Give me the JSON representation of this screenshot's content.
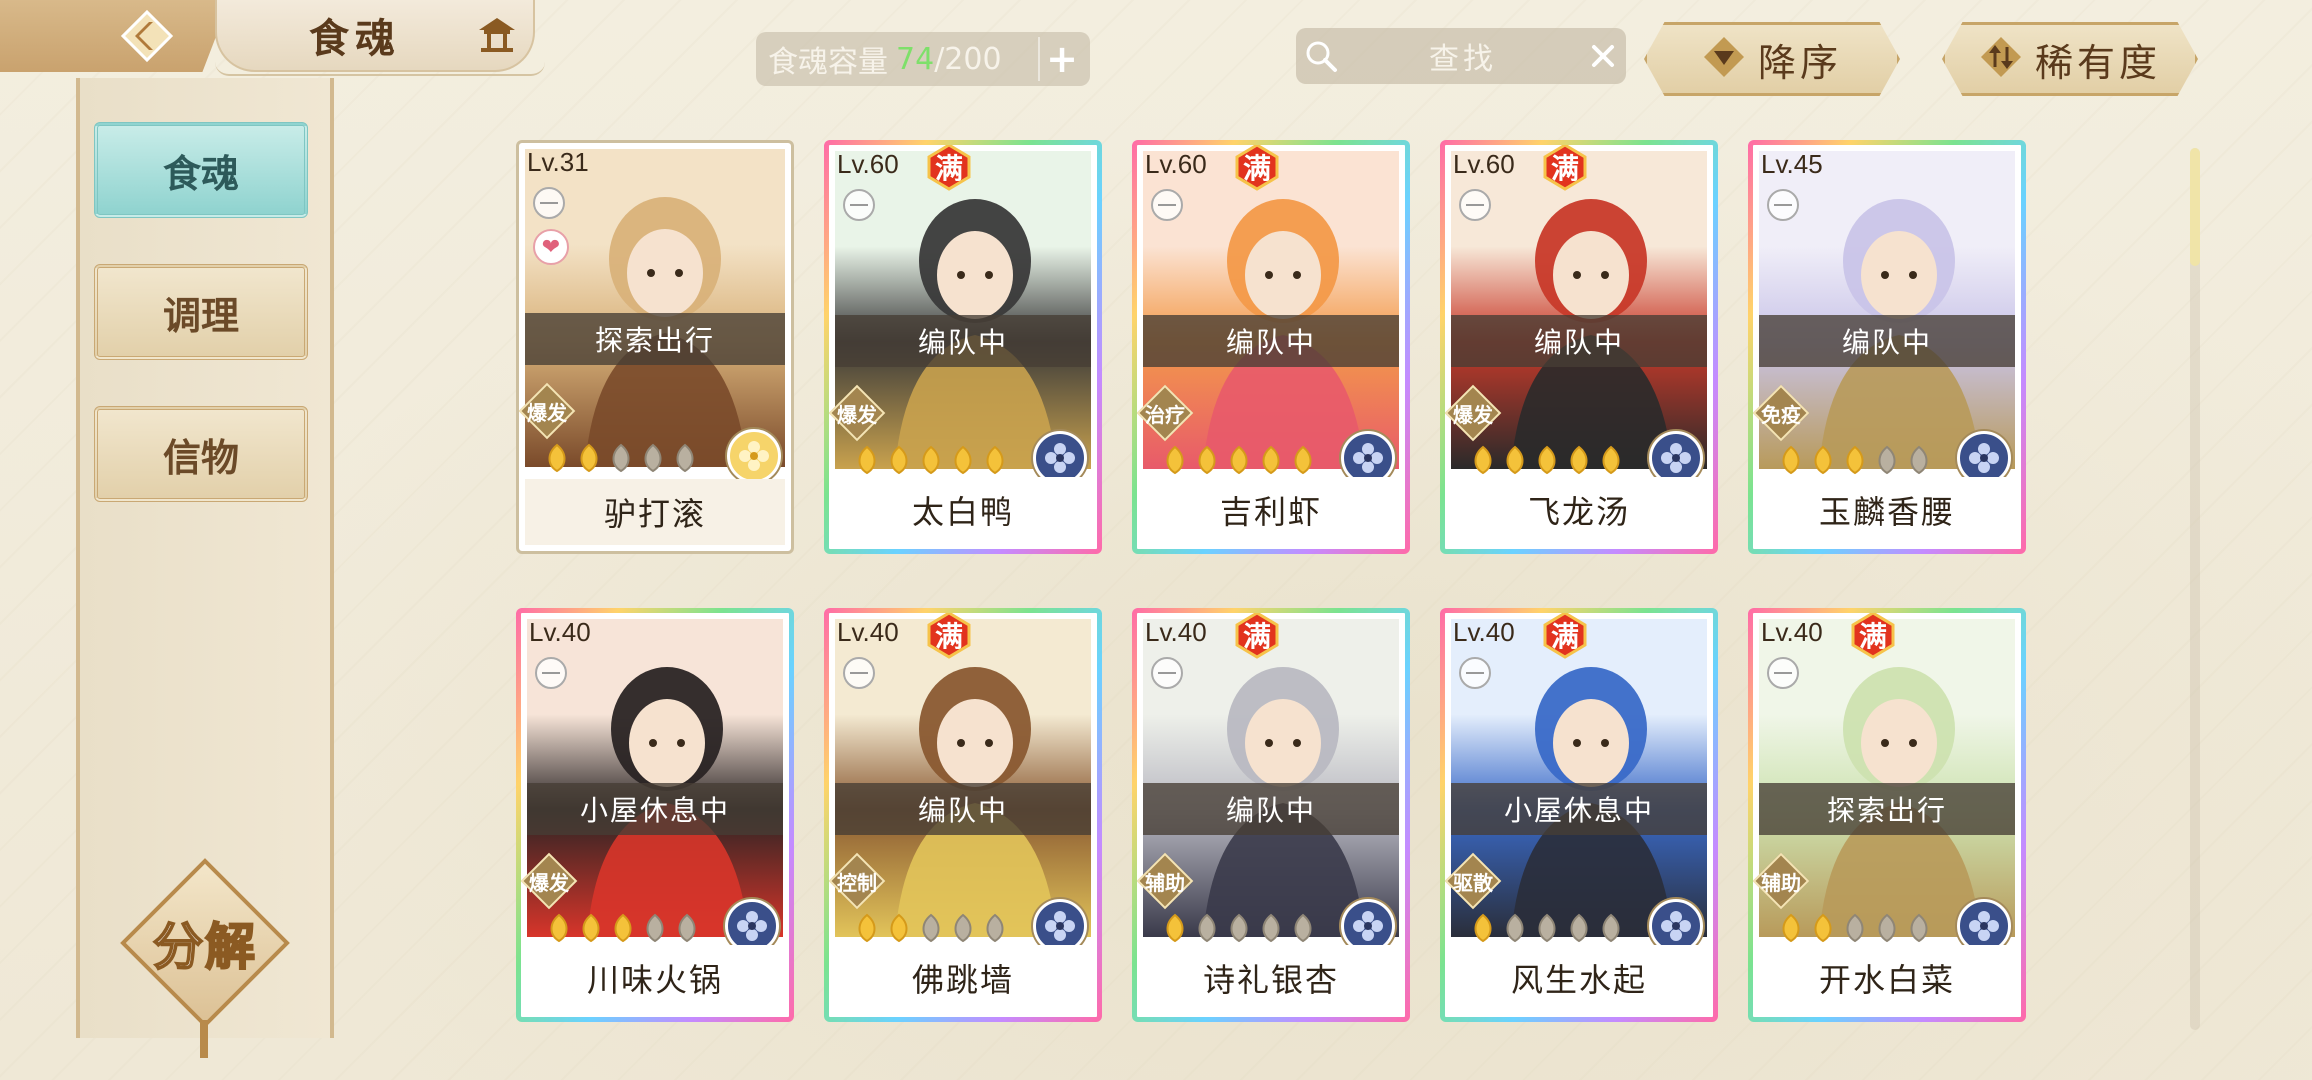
{
  "header": {
    "title": "食魂",
    "capacity": {
      "label": "食魂容量",
      "current": "74",
      "max": "/200"
    },
    "search_label": "查找",
    "sort_order_label": "降序",
    "sort_field_label": "稀有度"
  },
  "sidebar": {
    "tabs": [
      {
        "label": "食魂",
        "active": true
      },
      {
        "label": "调理",
        "active": false
      },
      {
        "label": "信物",
        "active": false
      }
    ],
    "decompose_label": "分解"
  },
  "card_badges": {
    "full": "满"
  },
  "cards": [
    {
      "level": "Lv.31",
      "full": false,
      "status": "探索出行",
      "role": "爆发",
      "stars": 2,
      "name": "驴打滚",
      "rare": false,
      "heart": true,
      "element": "gold-flower",
      "art": [
        "#f3e2c6",
        "#d9b27a",
        "#7a4a2a"
      ]
    },
    {
      "level": "Lv.60",
      "full": true,
      "status": "编队中",
      "role": "爆发",
      "stars": 5,
      "name": "太白鸭",
      "rare": true,
      "heart": false,
      "element": "blue-flower",
      "art": [
        "#e9f4e8",
        "#3a3a3a",
        "#c9a24e"
      ]
    },
    {
      "level": "Lv.60",
      "full": true,
      "status": "编队中",
      "role": "治疗",
      "stars": 5,
      "name": "吉利虾",
      "rare": true,
      "heart": false,
      "element": "blue-flower",
      "art": [
        "#fbe3d3",
        "#f39a4a",
        "#e85a6a"
      ]
    },
    {
      "level": "Lv.60",
      "full": true,
      "status": "编队中",
      "role": "爆发",
      "stars": 5,
      "name": "飞龙汤",
      "rare": true,
      "heart": false,
      "element": "blue-flower",
      "art": [
        "#f7e8d8",
        "#c83a2a",
        "#2a2a2a"
      ]
    },
    {
      "level": "Lv.45",
      "full": false,
      "status": "编队中",
      "role": "免疫",
      "stars": 3,
      "name": "玉麟香腰",
      "rare": true,
      "heart": false,
      "element": "blue-flower",
      "art": [
        "#f0eef8",
        "#c9c4e8",
        "#b89a5a"
      ]
    },
    {
      "level": "Lv.40",
      "full": false,
      "status": "小屋休息中",
      "role": "爆发",
      "stars": 3,
      "name": "川味火锅",
      "rare": true,
      "heart": false,
      "element": "blue-flower",
      "art": [
        "#f7e4d8",
        "#2a2424",
        "#d8352a"
      ]
    },
    {
      "level": "Lv.40",
      "full": true,
      "status": "编队中",
      "role": "控制",
      "stars": 2,
      "name": "佛跳墙",
      "rare": true,
      "heart": false,
      "element": "blue-flower",
      "art": [
        "#f4ead2",
        "#8a5a32",
        "#e2c45a"
      ]
    },
    {
      "level": "Lv.40",
      "full": true,
      "status": "编队中",
      "role": "辅助",
      "stars": 1,
      "name": "诗礼银杏",
      "rare": true,
      "heart": false,
      "element": "blue-flower",
      "art": [
        "#eef0ea",
        "#b9b9c2",
        "#3a3a4a"
      ]
    },
    {
      "level": "Lv.40",
      "full": true,
      "status": "小屋休息中",
      "role": "驱散",
      "stars": 1,
      "name": "风生水起",
      "rare": true,
      "heart": false,
      "element": "blue-flower",
      "art": [
        "#e4eefc",
        "#3a6ac8",
        "#2a2e3a"
      ]
    },
    {
      "level": "Lv.40",
      "full": true,
      "status": "探索出行",
      "role": "辅助",
      "stars": 2,
      "name": "开水白菜",
      "rare": true,
      "heart": false,
      "element": "blue-flower",
      "art": [
        "#f0f6e8",
        "#cde2b0",
        "#b89a5a"
      ]
    }
  ],
  "colors": {
    "accent_gold": "#c7a568",
    "active_tab": "#8fd3cf",
    "star": "#f4c23a"
  }
}
